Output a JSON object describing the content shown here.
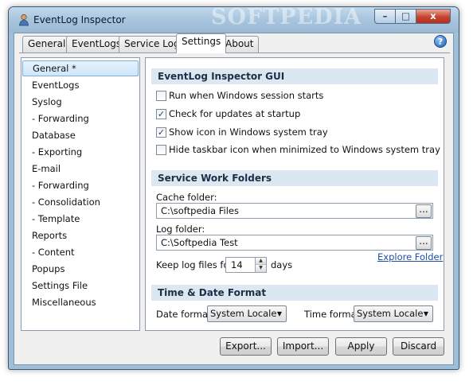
{
  "window": {
    "title": "EventLog Inspector",
    "watermark": "SOFTPEDIA",
    "controls": {
      "minimize": "–",
      "maximize": "□",
      "close": "x"
    },
    "help_glyph": "?"
  },
  "tabs": [
    {
      "label": "General",
      "active": false
    },
    {
      "label": "EventLogs",
      "active": false
    },
    {
      "label": "Service Log",
      "active": false
    },
    {
      "label": "Settings",
      "active": true
    },
    {
      "label": "About",
      "active": false
    }
  ],
  "nav": {
    "items": [
      {
        "label": "General *",
        "selected": true
      },
      {
        "label": "EventLogs"
      },
      {
        "label": "Syslog"
      },
      {
        "label": "-   Forwarding"
      },
      {
        "label": "Database"
      },
      {
        "label": "-   Exporting"
      },
      {
        "label": "E-mail"
      },
      {
        "label": "-   Forwarding"
      },
      {
        "label": "-   Consolidation"
      },
      {
        "label": "-   Template"
      },
      {
        "label": "Reports"
      },
      {
        "label": "-   Content"
      },
      {
        "label": "Popups"
      },
      {
        "label": "Settings File"
      },
      {
        "label": "Miscellaneous"
      }
    ]
  },
  "gui_section": {
    "title": "EventLog Inspector GUI",
    "options": [
      {
        "label": "Run when Windows session starts",
        "checked": false
      },
      {
        "label": "Check for updates at startup",
        "checked": true
      },
      {
        "label": "Show icon in Windows system tray",
        "checked": true
      },
      {
        "label": "Hide taskbar icon when minimized to Windows system tray",
        "checked": false
      }
    ]
  },
  "folders_section": {
    "title": "Service Work Folders",
    "cache_label": "Cache folder:",
    "cache_value": "C:\\softpedia Files",
    "log_label": "Log folder:",
    "log_value": "C:\\Softpedia Test",
    "browse_label": "...",
    "explore_link": "Explore Folder",
    "keep_label": "Keep log files for:",
    "keep_value": "14",
    "keep_unit": "days"
  },
  "time_section": {
    "title": "Time & Date Format",
    "date_label": "Date format:",
    "date_value": "System Locale",
    "time_label": "Time format:",
    "time_value": "System Locale"
  },
  "buttons": {
    "export": "Export...",
    "import": "Import...",
    "apply": "Apply",
    "discard": "Discard"
  }
}
